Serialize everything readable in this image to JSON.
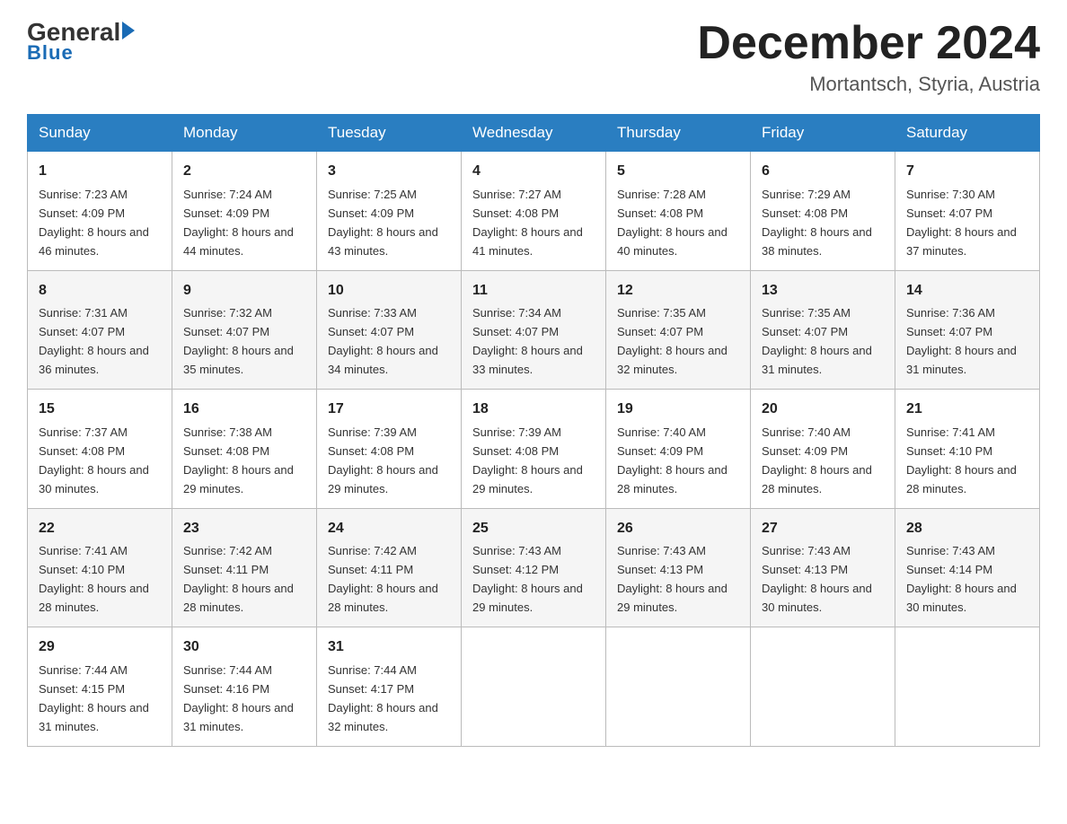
{
  "logo": {
    "general": "General",
    "blue": "Blue"
  },
  "title": {
    "month_year": "December 2024",
    "location": "Mortantsch, Styria, Austria"
  },
  "headers": [
    "Sunday",
    "Monday",
    "Tuesday",
    "Wednesday",
    "Thursday",
    "Friday",
    "Saturday"
  ],
  "weeks": [
    [
      {
        "day": "1",
        "sunrise": "7:23 AM",
        "sunset": "4:09 PM",
        "daylight": "8 hours and 46 minutes."
      },
      {
        "day": "2",
        "sunrise": "7:24 AM",
        "sunset": "4:09 PM",
        "daylight": "8 hours and 44 minutes."
      },
      {
        "day": "3",
        "sunrise": "7:25 AM",
        "sunset": "4:09 PM",
        "daylight": "8 hours and 43 minutes."
      },
      {
        "day": "4",
        "sunrise": "7:27 AM",
        "sunset": "4:08 PM",
        "daylight": "8 hours and 41 minutes."
      },
      {
        "day": "5",
        "sunrise": "7:28 AM",
        "sunset": "4:08 PM",
        "daylight": "8 hours and 40 minutes."
      },
      {
        "day": "6",
        "sunrise": "7:29 AM",
        "sunset": "4:08 PM",
        "daylight": "8 hours and 38 minutes."
      },
      {
        "day": "7",
        "sunrise": "7:30 AM",
        "sunset": "4:07 PM",
        "daylight": "8 hours and 37 minutes."
      }
    ],
    [
      {
        "day": "8",
        "sunrise": "7:31 AM",
        "sunset": "4:07 PM",
        "daylight": "8 hours and 36 minutes."
      },
      {
        "day": "9",
        "sunrise": "7:32 AM",
        "sunset": "4:07 PM",
        "daylight": "8 hours and 35 minutes."
      },
      {
        "day": "10",
        "sunrise": "7:33 AM",
        "sunset": "4:07 PM",
        "daylight": "8 hours and 34 minutes."
      },
      {
        "day": "11",
        "sunrise": "7:34 AM",
        "sunset": "4:07 PM",
        "daylight": "8 hours and 33 minutes."
      },
      {
        "day": "12",
        "sunrise": "7:35 AM",
        "sunset": "4:07 PM",
        "daylight": "8 hours and 32 minutes."
      },
      {
        "day": "13",
        "sunrise": "7:35 AM",
        "sunset": "4:07 PM",
        "daylight": "8 hours and 31 minutes."
      },
      {
        "day": "14",
        "sunrise": "7:36 AM",
        "sunset": "4:07 PM",
        "daylight": "8 hours and 31 minutes."
      }
    ],
    [
      {
        "day": "15",
        "sunrise": "7:37 AM",
        "sunset": "4:08 PM",
        "daylight": "8 hours and 30 minutes."
      },
      {
        "day": "16",
        "sunrise": "7:38 AM",
        "sunset": "4:08 PM",
        "daylight": "8 hours and 29 minutes."
      },
      {
        "day": "17",
        "sunrise": "7:39 AM",
        "sunset": "4:08 PM",
        "daylight": "8 hours and 29 minutes."
      },
      {
        "day": "18",
        "sunrise": "7:39 AM",
        "sunset": "4:08 PM",
        "daylight": "8 hours and 29 minutes."
      },
      {
        "day": "19",
        "sunrise": "7:40 AM",
        "sunset": "4:09 PM",
        "daylight": "8 hours and 28 minutes."
      },
      {
        "day": "20",
        "sunrise": "7:40 AM",
        "sunset": "4:09 PM",
        "daylight": "8 hours and 28 minutes."
      },
      {
        "day": "21",
        "sunrise": "7:41 AM",
        "sunset": "4:10 PM",
        "daylight": "8 hours and 28 minutes."
      }
    ],
    [
      {
        "day": "22",
        "sunrise": "7:41 AM",
        "sunset": "4:10 PM",
        "daylight": "8 hours and 28 minutes."
      },
      {
        "day": "23",
        "sunrise": "7:42 AM",
        "sunset": "4:11 PM",
        "daylight": "8 hours and 28 minutes."
      },
      {
        "day": "24",
        "sunrise": "7:42 AM",
        "sunset": "4:11 PM",
        "daylight": "8 hours and 28 minutes."
      },
      {
        "day": "25",
        "sunrise": "7:43 AM",
        "sunset": "4:12 PM",
        "daylight": "8 hours and 29 minutes."
      },
      {
        "day": "26",
        "sunrise": "7:43 AM",
        "sunset": "4:13 PM",
        "daylight": "8 hours and 29 minutes."
      },
      {
        "day": "27",
        "sunrise": "7:43 AM",
        "sunset": "4:13 PM",
        "daylight": "8 hours and 30 minutes."
      },
      {
        "day": "28",
        "sunrise": "7:43 AM",
        "sunset": "4:14 PM",
        "daylight": "8 hours and 30 minutes."
      }
    ],
    [
      {
        "day": "29",
        "sunrise": "7:44 AM",
        "sunset": "4:15 PM",
        "daylight": "8 hours and 31 minutes."
      },
      {
        "day": "30",
        "sunrise": "7:44 AM",
        "sunset": "4:16 PM",
        "daylight": "8 hours and 31 minutes."
      },
      {
        "day": "31",
        "sunrise": "7:44 AM",
        "sunset": "4:17 PM",
        "daylight": "8 hours and 32 minutes."
      },
      null,
      null,
      null,
      null
    ]
  ]
}
